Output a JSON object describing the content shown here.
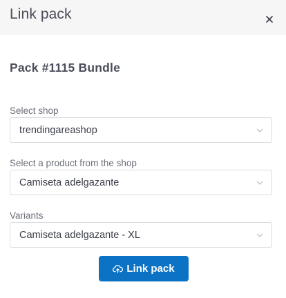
{
  "modal": {
    "title": "Link pack",
    "close_icon": "close-icon"
  },
  "pack": {
    "title": "Pack #1115 Bundle"
  },
  "fields": {
    "shop": {
      "label": "Select shop",
      "value": "trendingareashop"
    },
    "product": {
      "label": "Select a product from the shop",
      "value": "Camiseta adelgazante"
    },
    "variant": {
      "label": "Variants",
      "value": "Camiseta adelgazante - XL"
    }
  },
  "actions": {
    "link_label": "Link pack",
    "link_icon": "cloud-upload-icon"
  },
  "colors": {
    "header_bg": "#f6f6f7",
    "accent": "#0b72c4",
    "border": "#d8dbe0"
  }
}
